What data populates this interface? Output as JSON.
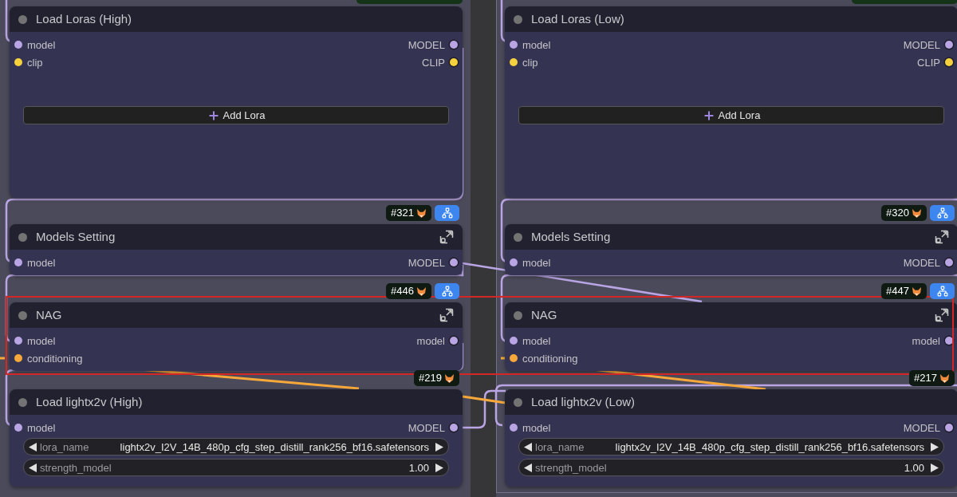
{
  "columns": [
    {
      "top_badge": true,
      "nodes": [
        {
          "kind": "lora_stack",
          "title": "Load Loras (High)",
          "inputs": [
            {
              "name": "model",
              "color": "#b9a5e4"
            },
            {
              "name": "clip",
              "color": "#f5d13d"
            }
          ],
          "outputs": [
            {
              "name": "MODEL",
              "color": "#b9a5e4"
            },
            {
              "name": "CLIP",
              "color": "#f5d13d"
            }
          ],
          "add_button": "Add Lora"
        },
        {
          "kind": "subgraph",
          "title": "Models Setting",
          "badge": {
            "text": "#321",
            "group_button": true
          },
          "inputs": [
            {
              "name": "model",
              "color": "#b9a5e4"
            }
          ],
          "outputs": [
            {
              "name": "MODEL",
              "color": "#b9a5e4"
            }
          ]
        },
        {
          "kind": "subgraph",
          "title": "NAG",
          "badge": {
            "text": "#446",
            "group_button": true
          },
          "inputs": [
            {
              "name": "model",
              "color": "#b9a5e4"
            },
            {
              "name": "conditioning",
              "color": "#f6a83a"
            }
          ],
          "outputs": [
            {
              "name": "model",
              "color": "#b9a5e4"
            }
          ]
        },
        {
          "kind": "loader",
          "title": "Load lightx2v (High)",
          "badge": {
            "text": "#219",
            "group_button": false
          },
          "inputs": [
            {
              "name": "model",
              "color": "#b9a5e4"
            }
          ],
          "outputs": [
            {
              "name": "MODEL",
              "color": "#b9a5e4"
            }
          ],
          "widgets": [
            {
              "label": "lora_name",
              "value": "lightx2v_I2V_14B_480p_cfg_step_distill_rank256_bf16.safetensors"
            },
            {
              "label": "strength_model",
              "value": "1.00"
            }
          ]
        }
      ]
    },
    {
      "top_badge": true,
      "nodes": [
        {
          "kind": "lora_stack",
          "title": "Load Loras (Low)",
          "inputs": [
            {
              "name": "model",
              "color": "#b9a5e4"
            },
            {
              "name": "clip",
              "color": "#f5d13d"
            }
          ],
          "outputs": [
            {
              "name": "MODEL",
              "color": "#b9a5e4"
            },
            {
              "name": "CLIP",
              "color": "#f5d13d"
            }
          ],
          "add_button": "Add Lora"
        },
        {
          "kind": "subgraph",
          "title": "Models Setting",
          "badge": {
            "text": "#320",
            "group_button": true
          },
          "inputs": [
            {
              "name": "model",
              "color": "#b9a5e4"
            }
          ],
          "outputs": [
            {
              "name": "MODEL",
              "color": "#b9a5e4"
            }
          ]
        },
        {
          "kind": "subgraph",
          "title": "NAG",
          "badge": {
            "text": "#447",
            "group_button": true
          },
          "inputs": [
            {
              "name": "model",
              "color": "#b9a5e4"
            },
            {
              "name": "conditioning",
              "color": "#f6a83a"
            }
          ],
          "outputs": [
            {
              "name": "model",
              "color": "#b9a5e4"
            }
          ]
        },
        {
          "kind": "loader",
          "title": "Load lightx2v (Low)",
          "badge": {
            "text": "#217",
            "group_button": false
          },
          "inputs": [
            {
              "name": "model",
              "color": "#b9a5e4"
            }
          ],
          "outputs": [
            {
              "name": "MODEL",
              "color": "#b9a5e4"
            }
          ],
          "widgets": [
            {
              "label": "lora_name",
              "value": "lightx2v_I2V_14B_480p_cfg_step_distill_rank256_bf16.safetensors"
            },
            {
              "label": "strength_model",
              "value": "1.00"
            }
          ]
        }
      ]
    }
  ],
  "highlight": true
}
